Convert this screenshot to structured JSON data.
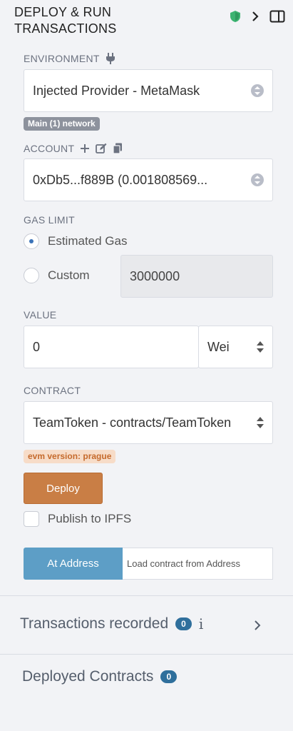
{
  "header": {
    "title": "DEPLOY & RUN TRANSACTIONS",
    "shield_color": "#3cb371"
  },
  "environment": {
    "label": "ENVIRONMENT",
    "value": "Injected Provider - MetaMask",
    "network_badge": "Main (1) network"
  },
  "account": {
    "label": "ACCOUNT",
    "value": "0xDb5...f889B (0.001808569..."
  },
  "gas": {
    "label": "GAS LIMIT",
    "estimated_label": "Estimated Gas",
    "custom_label": "Custom",
    "custom_value": "3000000"
  },
  "value": {
    "label": "VALUE",
    "amount": "0",
    "unit": "Wei"
  },
  "contract": {
    "label": "CONTRACT",
    "value": "TeamToken - contracts/TeamToken",
    "evm_badge": "evm version: prague"
  },
  "actions": {
    "deploy_label": "Deploy",
    "publish_label": "Publish to IPFS",
    "at_address_label": "At Address",
    "load_placeholder": "Load contract from Address"
  },
  "transactions": {
    "title": "Transactions recorded",
    "count": "0"
  },
  "deployed": {
    "title": "Deployed Contracts",
    "count": "0"
  },
  "colors": {
    "accent_orange": "#c97e45",
    "accent_blue": "#5d9ec6",
    "badge_blue": "#2f6f9c"
  }
}
